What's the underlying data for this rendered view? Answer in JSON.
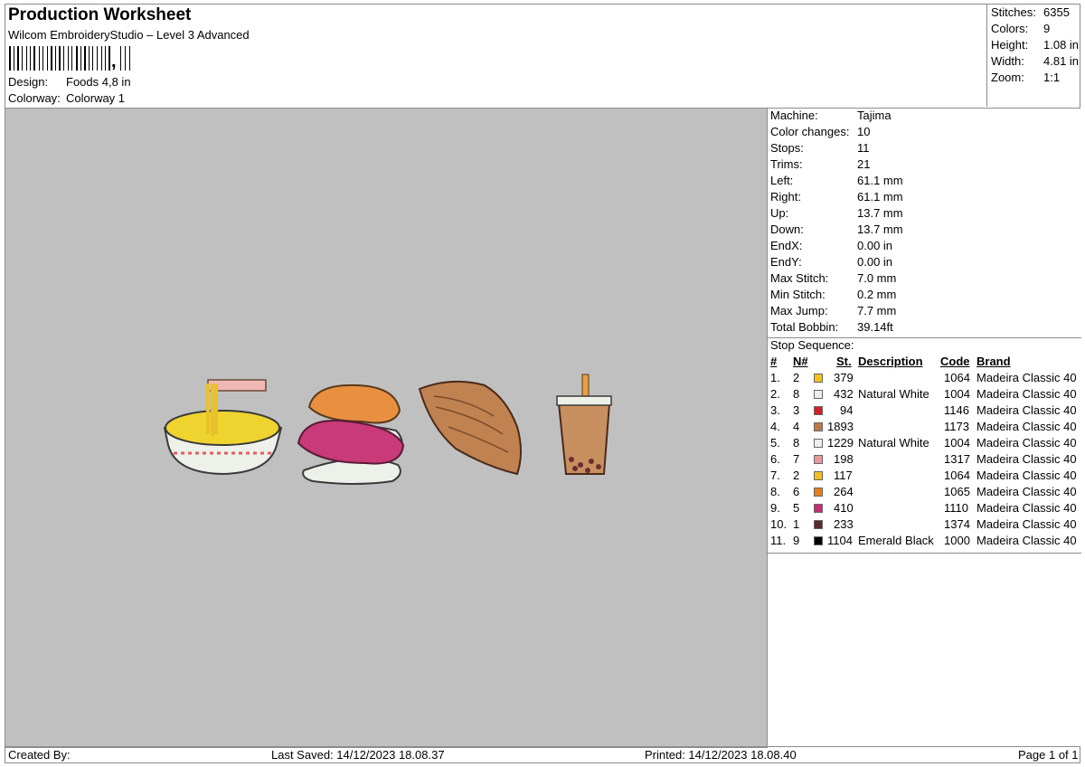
{
  "header": {
    "title": "Production Worksheet",
    "subtitle": "Wilcom EmbroideryStudio – Level 3 Advanced",
    "barcode_text": ",",
    "design_label": "Design:",
    "design_value": "Foods 4,8 in",
    "colorway_label": "Colorway:",
    "colorway_value": "Colorway 1"
  },
  "stats": [
    {
      "label": "Stitches:",
      "value": "6355"
    },
    {
      "label": "Colors:",
      "value": "9"
    },
    {
      "label": "Height:",
      "value": "1.08 in"
    },
    {
      "label": "Width:",
      "value": "4.81 in"
    },
    {
      "label": "Zoom:",
      "value": "1:1"
    }
  ],
  "machine_info": [
    {
      "label": "Machine:",
      "value": "Tajima"
    },
    {
      "label": "Color changes:",
      "value": "10"
    },
    {
      "label": "Stops:",
      "value": "11"
    },
    {
      "label": "Trims:",
      "value": "21"
    },
    {
      "label": "Left:",
      "value": "61.1 mm"
    },
    {
      "label": "Right:",
      "value": "61.1 mm"
    },
    {
      "label": "Up:",
      "value": "13.7 mm"
    },
    {
      "label": "Down:",
      "value": "13.7 mm"
    },
    {
      "label": "EndX:",
      "value": "0.00 in"
    },
    {
      "label": "EndY:",
      "value": "0.00 in"
    },
    {
      "label": "Max Stitch:",
      "value": "7.0 mm"
    },
    {
      "label": "Min Stitch:",
      "value": "0.2 mm"
    },
    {
      "label": "Max Jump:",
      "value": "7.7 mm"
    },
    {
      "label": "Total Bobbin:",
      "value": "39.14ft"
    }
  ],
  "stop_sequence": {
    "title": "Stop Sequence:",
    "headers": {
      "num": "#",
      "needle": "N#",
      "stitches": "St.",
      "description": "Description",
      "code": "Code",
      "brand": "Brand"
    },
    "rows": [
      {
        "num": "1.",
        "needle": "2",
        "color": "#f5c01e",
        "stitches": "379",
        "description": "",
        "code": "1064",
        "brand": "Madeira Classic 40"
      },
      {
        "num": "2.",
        "needle": "8",
        "color": "#eeeeee",
        "stitches": "432",
        "description": "Natural White",
        "code": "1004",
        "brand": "Madeira Classic 40"
      },
      {
        "num": "3.",
        "needle": "3",
        "color": "#d42027",
        "stitches": "94",
        "description": "",
        "code": "1146",
        "brand": "Madeira Classic 40"
      },
      {
        "num": "4.",
        "needle": "4",
        "color": "#bb7a4a",
        "stitches": "1893",
        "description": "",
        "code": "1173",
        "brand": "Madeira Classic 40"
      },
      {
        "num": "5.",
        "needle": "8",
        "color": "#eeeeee",
        "stitches": "1229",
        "description": "Natural White",
        "code": "1004",
        "brand": "Madeira Classic 40"
      },
      {
        "num": "6.",
        "needle": "7",
        "color": "#e89a98",
        "stitches": "198",
        "description": "",
        "code": "1317",
        "brand": "Madeira Classic 40"
      },
      {
        "num": "7.",
        "needle": "2",
        "color": "#f5c01e",
        "stitches": "117",
        "description": "",
        "code": "1064",
        "brand": "Madeira Classic 40"
      },
      {
        "num": "8.",
        "needle": "6",
        "color": "#e5801e",
        "stitches": "264",
        "description": "",
        "code": "1065",
        "brand": "Madeira Classic 40"
      },
      {
        "num": "9.",
        "needle": "5",
        "color": "#c42f73",
        "stitches": "410",
        "description": "",
        "code": "1110",
        "brand": "Madeira Classic 40"
      },
      {
        "num": "10.",
        "needle": "1",
        "color": "#5a2a2a",
        "stitches": "233",
        "description": "",
        "code": "1374",
        "brand": "Madeira Classic 40"
      },
      {
        "num": "11.",
        "needle": "9",
        "color": "#000000",
        "stitches": "1104",
        "description": "Emerald Black",
        "code": "1000",
        "brand": "Madeira Classic 40"
      }
    ]
  },
  "footer": {
    "created_by": "Created By:",
    "last_saved": "Last Saved: 14/12/2023 18.08.37",
    "printed": "Printed: 14/12/2023 18.08.40",
    "page": "Page 1 of 1"
  }
}
